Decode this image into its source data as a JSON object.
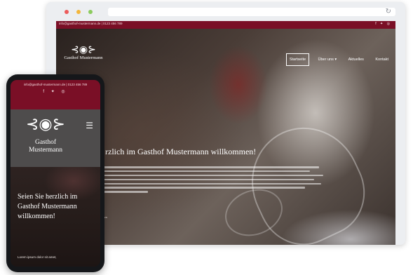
{
  "site": {
    "contact": "info@gasthof-mustermann.de | 0123 456 789",
    "contact_mobile": "info@gasthof-mustermann.de | 0123 456 789",
    "social_icons": [
      "facebook-icon",
      "twitter-icon",
      "instagram-icon"
    ],
    "social_glyphs": "f ✦ ◎",
    "brand_name": "Gasthof Mustermann",
    "brand_accent": "#7a0f26"
  },
  "desktop": {
    "nav": [
      "Startseite",
      "Über uns ▾",
      "Aktuelles",
      "Kontakt"
    ],
    "headline": "…rzlich im Gasthof Mustermann willkommen!",
    "small_text": "… Team"
  },
  "mobile": {
    "headline": "Seien Sie herzlich im Gasthof Mustermann willkommen!",
    "lorem": "Lorem ipsum dolor sit amet,"
  },
  "browser": {
    "reload_icon": "reload-icon"
  }
}
